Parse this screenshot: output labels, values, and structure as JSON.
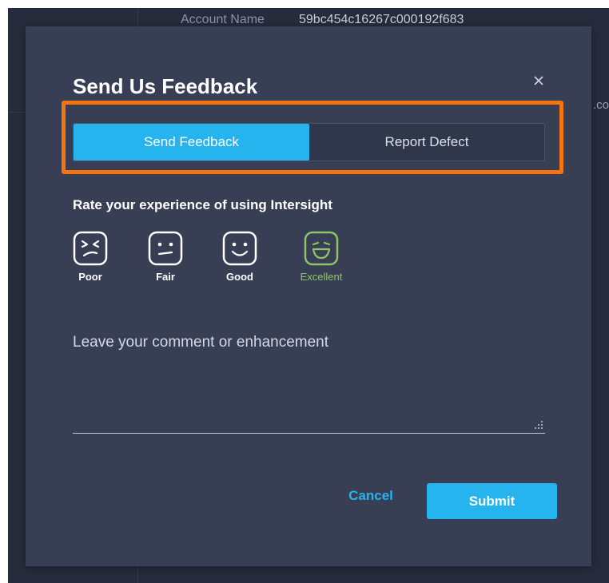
{
  "background": {
    "account_label": "Account Name",
    "account_value": "59bc454c16267c000192f683",
    "peek_text": ".co"
  },
  "dialog": {
    "title": "Send Us Feedback",
    "close_icon": "close-icon",
    "tabs": [
      {
        "label": "Send Feedback",
        "active": true
      },
      {
        "label": "Report Defect",
        "active": false
      }
    ],
    "rating_prompt": "Rate your experience of using Intersight",
    "ratings": [
      {
        "label": "Poor",
        "icon": "poor-face-icon",
        "selected": false
      },
      {
        "label": "Fair",
        "icon": "fair-face-icon",
        "selected": false
      },
      {
        "label": "Good",
        "icon": "good-face-icon",
        "selected": false
      },
      {
        "label": "Excellent",
        "icon": "excellent-face-icon",
        "selected": true
      }
    ],
    "comment": {
      "value": "",
      "placeholder": "Leave your comment or enhancement"
    },
    "cancel_label": "Cancel",
    "submit_label": "Submit"
  },
  "colors": {
    "accent": "#25b4ee",
    "highlight": "#f6740d",
    "selected_rating": "#8fc36a",
    "dialog_bg": "#383f55",
    "page_bg": "#262c3b"
  }
}
